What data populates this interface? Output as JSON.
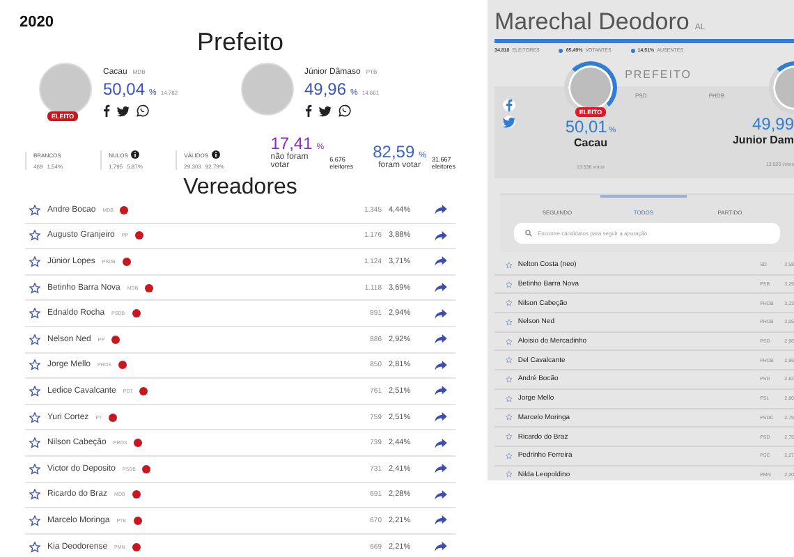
{
  "left": {
    "year": "2020",
    "mayor_title": "Prefeito",
    "candidates": [
      {
        "name": "Cacau",
        "party": "MDB",
        "percent": "50,04",
        "unit": "%",
        "votes": "14.782",
        "badge": "ELEITO"
      },
      {
        "name": "Júnior Dâmaso",
        "party": "PTB",
        "percent": "49,96",
        "unit": "%",
        "votes": "14.661"
      }
    ],
    "stats": [
      {
        "label": "BRANCOS",
        "info": false,
        "count": "469",
        "percent": "1,54%"
      },
      {
        "label": "NULOS",
        "info": true,
        "count": "1.795",
        "percent": "5,87%"
      },
      {
        "label": "VÁLIDOS",
        "info": true,
        "count": "29.303",
        "percent": "92,79%"
      }
    ],
    "turnout": [
      {
        "percent": "17,41",
        "unit": "%",
        "caption": "não foram votar",
        "count": "6.676",
        "count_label": "eleitores",
        "color": "#8e2bc7"
      },
      {
        "percent": "82,59",
        "unit": "%",
        "caption": "foram votar",
        "count": "31.667",
        "count_label": "eleitores",
        "color": "#3b63c9"
      }
    ],
    "council_title": "Vereadores",
    "council": [
      {
        "name": "Andre Bocao",
        "party": "MDB",
        "elected": true,
        "votes": "1.345",
        "percent": "4,44%"
      },
      {
        "name": "Augusto Granjeiro",
        "party": "PP",
        "elected": true,
        "votes": "1.176",
        "percent": "3,88%"
      },
      {
        "name": "Júnior Lopes",
        "party": "PSDB",
        "elected": true,
        "votes": "1.124",
        "percent": "3,71%"
      },
      {
        "name": "Betinho Barra Nova",
        "party": "MDB",
        "elected": true,
        "votes": "1.118",
        "percent": "3,69%"
      },
      {
        "name": "Ednaldo Rocha",
        "party": "PSDB",
        "elected": true,
        "votes": "891",
        "percent": "2,94%"
      },
      {
        "name": "Nelson Ned",
        "party": "PP",
        "elected": true,
        "votes": "886",
        "percent": "2,92%"
      },
      {
        "name": "Jorge Mello",
        "party": "PROS",
        "elected": true,
        "votes": "850",
        "percent": "2,81%"
      },
      {
        "name": "Ledice Cavalcante",
        "party": "PDT",
        "elected": true,
        "votes": "761",
        "percent": "2,51%"
      },
      {
        "name": "Yuri Cortez",
        "party": "PT",
        "elected": true,
        "votes": "759",
        "percent": "2,51%"
      },
      {
        "name": "Nilson Cabeção",
        "party": "PROS",
        "elected": true,
        "votes": "739",
        "percent": "2,44%"
      },
      {
        "name": "Victor do Deposito",
        "party": "PSDB",
        "elected": true,
        "votes": "731",
        "percent": "2,41%"
      },
      {
        "name": "Ricardo do Braz",
        "party": "MDB",
        "elected": true,
        "votes": "691",
        "percent": "2,28%"
      },
      {
        "name": "Marcelo Moringa",
        "party": "PTB",
        "elected": true,
        "votes": "670",
        "percent": "2,21%"
      },
      {
        "name": "Kia Deodorense",
        "party": "PMN",
        "elected": true,
        "votes": "669",
        "percent": "2,21%"
      }
    ]
  },
  "right": {
    "city": "Marechal Deodoro",
    "state": "AL",
    "progress": {
      "level": 1
    },
    "stats": [
      {
        "value": "34.818",
        "label": "ELEITORES",
        "dot": false
      },
      {
        "value": "85,49%",
        "label": "VOTANTES",
        "dot": true
      },
      {
        "value": "14,51%",
        "label": "AUSENTES",
        "dot": true
      }
    ],
    "office": "PREFEITO",
    "candidates": [
      {
        "name": "Cacau",
        "party": "PSD",
        "percent": "50,01",
        "unit": "%",
        "votes": "13.536 votos",
        "badge": "ELEITO"
      },
      {
        "name": "Junior Dam",
        "party": "PHDB",
        "percent": "49,99",
        "votes": "13.526 votos"
      }
    ],
    "tabs": [
      {
        "label": "SEGUINDO",
        "selected": false
      },
      {
        "label": "TODOS",
        "selected": true
      },
      {
        "label": "PARTIDO",
        "selected": false
      }
    ],
    "search": {
      "placeholder": "Encontre candidatos para seguir a apuração"
    },
    "council": [
      {
        "name": "Nelton Costa (neo)",
        "party": "SD",
        "percent": "3,58"
      },
      {
        "name": "Betinho Barra Nova",
        "party": "PSB",
        "percent": "3,29"
      },
      {
        "name": "Nilson Cabeção",
        "party": "PHDB",
        "percent": "3,23"
      },
      {
        "name": "Nelson Ned",
        "party": "PHDB",
        "percent": "3,05"
      },
      {
        "name": "Aloisio do Mercadinho",
        "party": "PSD",
        "percent": "2,96"
      },
      {
        "name": "Del Cavalcante",
        "party": "PHDB",
        "percent": "2,89"
      },
      {
        "name": "André Bocão",
        "party": "PSD",
        "percent": "2,82"
      },
      {
        "name": "Jorge Mello",
        "party": "PSL",
        "percent": "2,80"
      },
      {
        "name": "Marcelo Moringa",
        "party": "PSDC",
        "percent": "2,79"
      },
      {
        "name": "Ricardo do Braz",
        "party": "PSD",
        "percent": "2,75"
      },
      {
        "name": "Pedrinho Ferreira",
        "party": "PSC",
        "percent": "2,27"
      },
      {
        "name": "Nilda Leopoldino",
        "party": "PMN",
        "percent": "2,20"
      }
    ]
  }
}
